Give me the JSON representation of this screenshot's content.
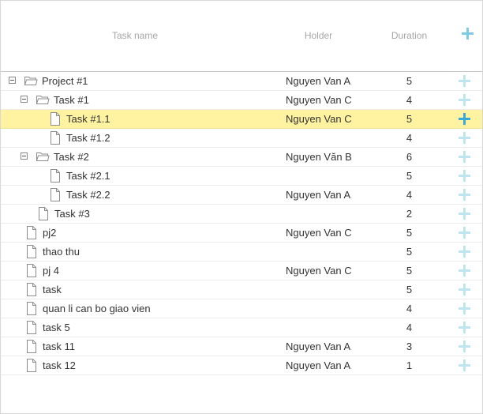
{
  "header": {
    "task_name": "Task name",
    "holder": "Holder",
    "duration": "Duration",
    "add_icon": "plus-icon"
  },
  "tasks": [
    {
      "name": "Project #1",
      "holder": "Nguyen Van A",
      "duration": "5",
      "level": 0,
      "type": "folder",
      "expanded": true
    },
    {
      "name": "Task #1",
      "holder": "Nguyen Van C",
      "duration": "4",
      "level": 1,
      "type": "folder",
      "expanded": true
    },
    {
      "name": "Task #1.1",
      "holder": "Nguyen Van C",
      "duration": "5",
      "level": 2,
      "type": "file",
      "selected": true
    },
    {
      "name": "Task #1.2",
      "holder": "",
      "duration": "4",
      "level": 2,
      "type": "file"
    },
    {
      "name": "Task #2",
      "holder": "Nguyen Văn B",
      "duration": "6",
      "level": 1,
      "type": "folder",
      "expanded": true
    },
    {
      "name": "Task #2.1",
      "holder": "",
      "duration": "5",
      "level": 2,
      "type": "file"
    },
    {
      "name": "Task #2.2",
      "holder": "Nguyen Van A",
      "duration": "4",
      "level": 2,
      "type": "file"
    },
    {
      "name": "Task #3",
      "holder": "",
      "duration": "2",
      "level": 1,
      "type": "file"
    },
    {
      "name": "pj2",
      "holder": "Nguyen Van C",
      "duration": "5",
      "level": 0,
      "type": "file"
    },
    {
      "name": "thao thu",
      "holder": "",
      "duration": "5",
      "level": 0,
      "type": "file"
    },
    {
      "name": "pj 4",
      "holder": "Nguyen Van C",
      "duration": "5",
      "level": 0,
      "type": "file"
    },
    {
      "name": "task",
      "holder": "",
      "duration": "5",
      "level": 0,
      "type": "file"
    },
    {
      "name": "quan li can bo giao vien",
      "holder": "",
      "duration": "4",
      "level": 0,
      "type": "file"
    },
    {
      "name": "task 5",
      "holder": "",
      "duration": "4",
      "level": 0,
      "type": "file"
    },
    {
      "name": "task 11",
      "holder": "Nguyen Van A",
      "duration": "3",
      "level": 0,
      "type": "file"
    },
    {
      "name": "task 12",
      "holder": "Nguyen Van A",
      "duration": "1",
      "level": 0,
      "type": "file"
    }
  ],
  "colors": {
    "selected_row": "#fff3a1",
    "add_icon": "#bfe6f0",
    "add_icon_active": "#38a9d8"
  }
}
